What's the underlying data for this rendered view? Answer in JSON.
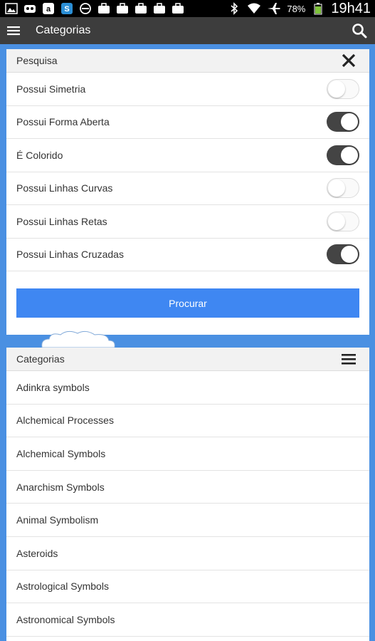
{
  "status_bar": {
    "battery_percent": "78%",
    "time": "19h41",
    "left_icons": [
      "gallery-icon",
      "robot-icon",
      "amazon-icon",
      "skype-icon",
      "block-icon",
      "bag-icon",
      "bag-icon",
      "bag-icon",
      "bag-icon",
      "bag-icon"
    ],
    "right_icons": [
      "bluetooth-icon",
      "wifi-icon",
      "airplane-icon",
      "battery-icon"
    ]
  },
  "app_bar": {
    "title": "Categorias",
    "menu_icon": "hamburger-icon",
    "search_icon": "search-icon"
  },
  "search_panel": {
    "title": "Pesquisa",
    "close_icon": "close-icon",
    "filters": [
      {
        "label": "Possui Simetria",
        "on": false
      },
      {
        "label": "Possui Forma Aberta",
        "on": true
      },
      {
        "label": "É Colorido",
        "on": true
      },
      {
        "label": "Possui Linhas Curvas",
        "on": false
      },
      {
        "label": "Possui Linhas Retas",
        "on": false
      },
      {
        "label": "Possui Linhas Cruzadas",
        "on": true
      }
    ],
    "submit_label": "Procurar"
  },
  "categories_panel": {
    "title": "Categorias",
    "menu_icon": "hamburger-icon",
    "items": [
      "Adinkra symbols",
      "Alchemical Processes",
      "Alchemical Symbols",
      "Anarchism Symbols",
      "Animal Symbolism",
      "Asteroids",
      "Astrological Symbols",
      "Astronomical Symbols"
    ]
  },
  "colors": {
    "background": "#4a90e2",
    "app_bar": "#3d3d3d",
    "primary_button": "#3f87f2",
    "toggle_on": "#444444"
  }
}
